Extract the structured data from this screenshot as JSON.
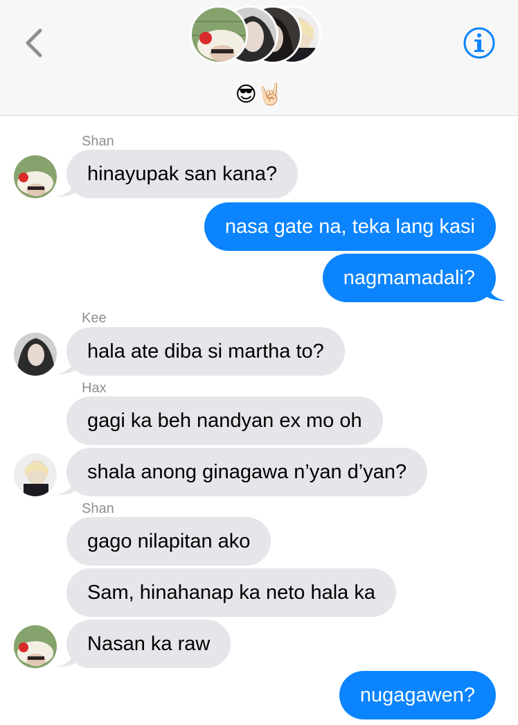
{
  "header": {
    "group_name": "😎🤘🏻",
    "members": [
      "Shan",
      "Kee",
      "Hax",
      "Sam"
    ],
    "accent_color": "#0b84fe"
  },
  "messages": [
    {
      "sender": "Shan",
      "text": "hinayupak san kana?"
    },
    {
      "sender": "me",
      "text": "nasa gate na, teka lang kasi"
    },
    {
      "sender": "me",
      "text": "nagmamadali?"
    },
    {
      "sender": "Kee",
      "text": "hala ate diba si martha to?"
    },
    {
      "sender": "Hax",
      "text": "gagi ka beh nandyan ex mo oh"
    },
    {
      "sender": "Hax",
      "text": "shala anong ginagawa n’yan d’yan?"
    },
    {
      "sender": "Shan",
      "text": "gago nilapitan ako"
    },
    {
      "sender": "Shan",
      "text": "Sam, hinahanap ka neto hala ka"
    },
    {
      "sender": "Shan",
      "text": "Nasan ka raw"
    },
    {
      "sender": "me",
      "text": "nugagawen?"
    }
  ],
  "labels": {
    "shan_1": "Shan",
    "kee": "Kee",
    "hax": "Hax",
    "shan_2": "Shan"
  },
  "icons": {
    "back": "chevron-left-icon",
    "info": "info-circle-icon"
  },
  "colors": {
    "incoming_bubble": "#e5e5ea",
    "outgoing_bubble": "#0b84fe",
    "sender_label": "#8e8e93"
  }
}
